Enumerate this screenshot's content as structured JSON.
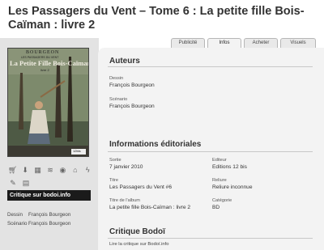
{
  "page": {
    "title": "Les Passagers du Vent – Tome 6 : La petite fille Bois-Caïman : livre 2"
  },
  "cover": {
    "author": "BOURGEON",
    "series": "LES PASSAGERS DU VENT",
    "title": "La Petite Fille Bois-Caïman",
    "subtitle": "livre 2",
    "publisher": "12bis"
  },
  "actions": {
    "row1": [
      "cart-icon",
      "download-icon",
      "library-icon",
      "stack-icon",
      "eye-icon",
      "home-icon",
      "lightning-icon"
    ],
    "row2": [
      "edit-icon",
      "note-icon"
    ],
    "critique_button": "Critique sur bodoi.info"
  },
  "credits": [
    {
      "key": "Dessin",
      "value": "François Bourgeon"
    },
    {
      "key": "Scénario",
      "value": "François Bourgeon"
    }
  ],
  "tabs": [
    {
      "label": "Publicité",
      "active": false
    },
    {
      "label": "Infos",
      "active": true
    },
    {
      "label": "Acheter",
      "active": false
    },
    {
      "label": "Visuels",
      "active": false
    }
  ],
  "auteurs": {
    "heading": "Auteurs",
    "dessin_label": "Dessin",
    "dessin_value": "François Bourgeon",
    "scenario_label": "Scénario",
    "scenario_value": "François Bourgeon"
  },
  "editorial": {
    "heading": "Informations éditoriales",
    "sortie_label": "Sortie",
    "sortie_value": "7 janvier 2010",
    "editeur_label": "Editeur",
    "editeur_value": "Editions 12 bis",
    "titre_label": "Titre",
    "titre_value": "Les Passagers du Vent #6",
    "reliure_label": "Reliure",
    "reliure_value": "Reliure inconnue",
    "album_label": "Titre de l'album",
    "album_value": "La petite fille Bois-Caïman : livre 2",
    "categorie_label": "Catégorie",
    "categorie_value": "BD"
  },
  "critique": {
    "heading": "Critique Bodoï",
    "link": "Lire la critique sur Bodoï.info"
  }
}
